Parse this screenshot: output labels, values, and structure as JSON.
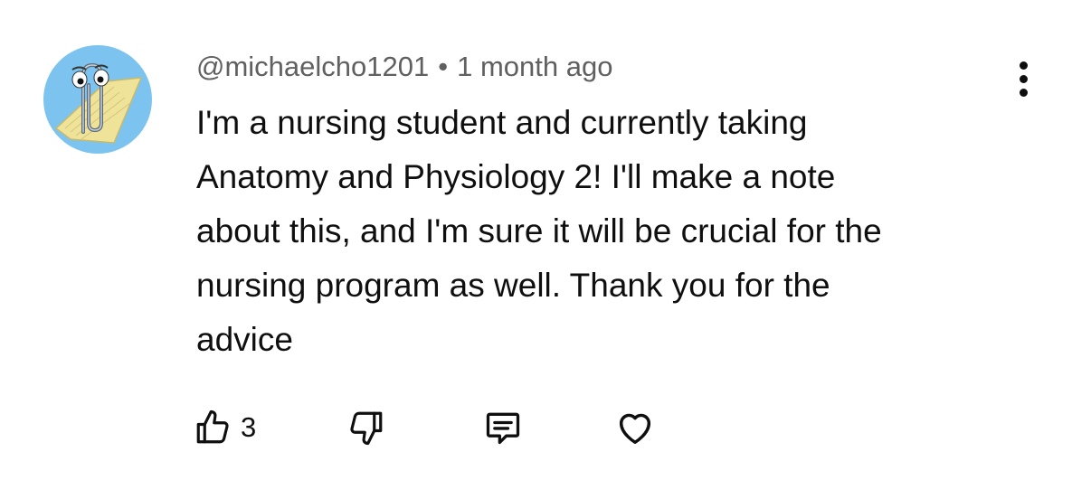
{
  "comment": {
    "author": "@michaelcho1201",
    "separator": "•",
    "timestamp": "1 month ago",
    "text_lines": [
      "I'm a nursing student and currently taking",
      "Anatomy and Physiology 2! I'll make a note",
      "about this, and I'm sure it will be crucial for the",
      "nursing program as well. Thank you for the",
      "advice"
    ],
    "like_count": "3",
    "avatar_icon": "paperclip-assistant-icon",
    "colors": {
      "avatar_bg": "#7cc4ef",
      "meta_text": "#606060",
      "body_text": "#0f0f0f"
    }
  },
  "actions": {
    "like_icon": "thumbs-up-icon",
    "dislike_icon": "thumbs-down-icon",
    "reply_icon": "comment-icon",
    "heart_icon": "heart-icon",
    "more_icon": "more-vertical-icon"
  }
}
